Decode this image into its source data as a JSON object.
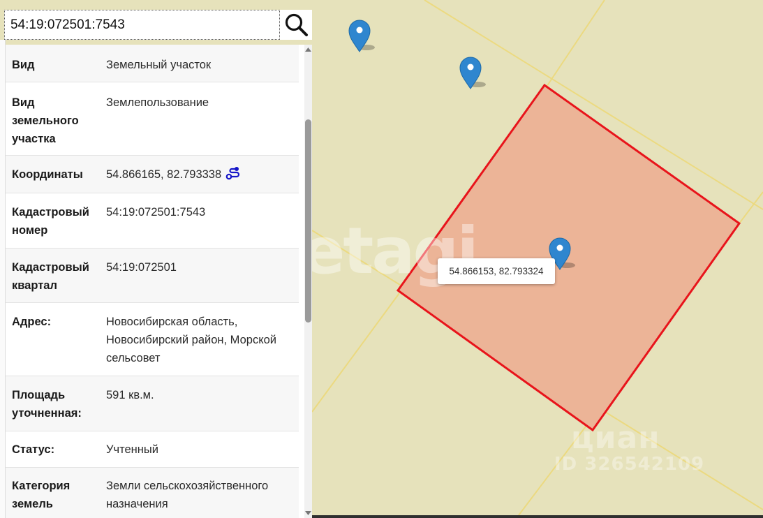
{
  "search": {
    "value": "54:19:072501:7543",
    "icon": "search-icon"
  },
  "rows": [
    {
      "label": "Вид",
      "value": "Земельный участок"
    },
    {
      "label": "Вид земельного участка",
      "value": "Землепользование"
    },
    {
      "label": "Координаты",
      "value": "54.866165, 82.793338",
      "icon": "route-icon"
    },
    {
      "label": "Кадастровый номер",
      "value": "54:19:072501:7543"
    },
    {
      "label": "Кадастровый квартал",
      "value": "54:19:072501"
    },
    {
      "label": "Адрес:",
      "value": "Новосибирская область, Новосибирский район, Морской сельсовет"
    },
    {
      "label": "Площадь уточненная:",
      "value": "591 кв.м."
    },
    {
      "label": "Статус:",
      "value": "Учтенный"
    },
    {
      "label": "Категория земель",
      "value": "Земли сельскохозяйственного назначения"
    }
  ],
  "map": {
    "popup_text": "54.866153, 82.793324",
    "markers": [
      "map-pin-icon",
      "map-pin-icon",
      "map-pin-icon"
    ],
    "parcel_fill": "#ecb497",
    "parcel_stroke": "#e8141b",
    "background_color": "#e6e2bb",
    "watermarks": [
      "etagi",
      "циан",
      "ID 326542109"
    ]
  },
  "colors": {
    "link_icon": "#1515c8",
    "marker": "#2f86cf"
  }
}
